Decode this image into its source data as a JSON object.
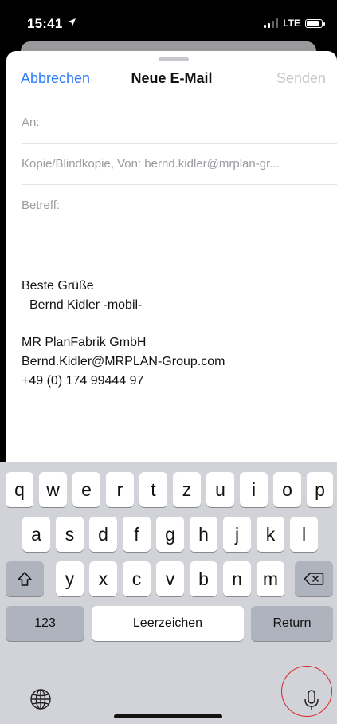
{
  "status_bar": {
    "time": "15:41",
    "location_icon": "location-arrow-icon",
    "network": "LTE"
  },
  "compose": {
    "cancel_label": "Abbrechen",
    "title": "Neue E-Mail",
    "send_label": "Senden",
    "to_label": "An:",
    "cc_from": "Kopie/Blindkopie, Von:  bernd.kidler@mrplan-gr...",
    "subject_label": "Betreff:",
    "body": {
      "line1": "Beste Grüße",
      "line2": "Bernd Kidler -mobil-",
      "line3": "MR PlanFabrik GmbH",
      "line4": "Bernd.Kidler@MRPLAN-Group.com",
      "line5": "+49 (0) 174 99444 97"
    }
  },
  "keyboard": {
    "row1": [
      "q",
      "w",
      "e",
      "r",
      "t",
      "z",
      "u",
      "i",
      "o",
      "p"
    ],
    "row2": [
      "a",
      "s",
      "d",
      "f",
      "g",
      "h",
      "j",
      "k",
      "l"
    ],
    "row3": [
      "y",
      "x",
      "c",
      "v",
      "b",
      "n",
      "m"
    ],
    "numbers_label": "123",
    "space_label": "Leerzeichen",
    "return_label": "Return"
  },
  "colors": {
    "accent": "#2f7cf6",
    "disabled": "#c7c7cc",
    "highlight_circle": "#d6262b"
  }
}
